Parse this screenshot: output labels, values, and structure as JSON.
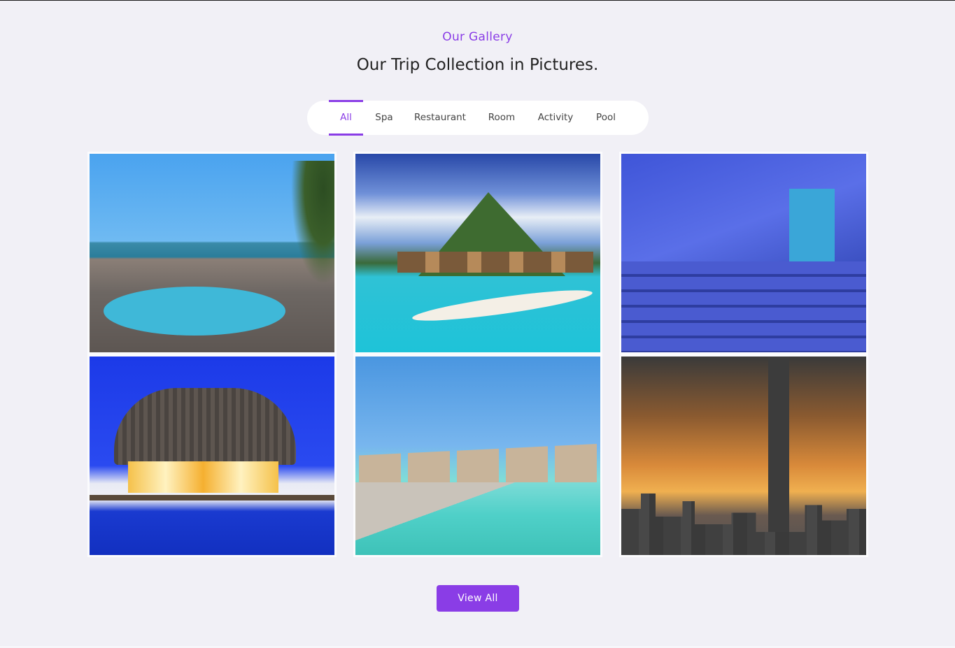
{
  "header": {
    "subtitle": "Our Gallery",
    "title": "Our Trip Collection in Pictures."
  },
  "tabs": [
    {
      "label": "All",
      "active": true
    },
    {
      "label": "Spa",
      "active": false
    },
    {
      "label": "Restaurant",
      "active": false
    },
    {
      "label": "Room",
      "active": false
    },
    {
      "label": "Activity",
      "active": false
    },
    {
      "label": "Pool",
      "active": false
    }
  ],
  "gallery": [
    {
      "scene": "beach resort pool with palm trees"
    },
    {
      "scene": "overwater bungalows below a green mountain peak"
    },
    {
      "scene": "blue painted alley with stairs"
    },
    {
      "scene": "lit thatched hut on water at dusk"
    },
    {
      "scene": "overwater huts along a wooden pier"
    },
    {
      "scene": "city skyline silhouette at sunset"
    }
  ],
  "actions": {
    "view_all_label": "View All"
  },
  "colors": {
    "accent": "#8a3de6",
    "background": "#f1f0f6"
  }
}
